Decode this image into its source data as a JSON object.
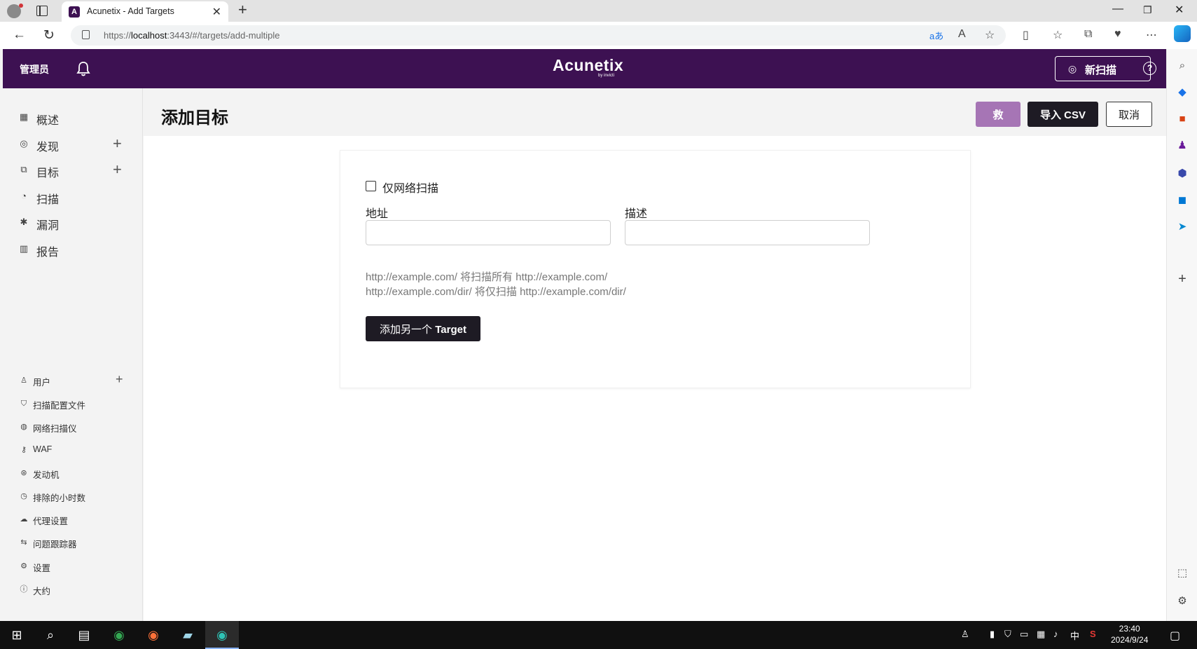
{
  "browser": {
    "tab_title": "Acunetix - Add Targets",
    "tab_favicon": "A",
    "url_prefix": "https://",
    "url_host": "localhost",
    "url_rest": ":3443/#/targets/add-multiple"
  },
  "header": {
    "user": "管理员",
    "logo": "Acunetix",
    "logo_sub": "by invicti",
    "new_scan": "新扫描",
    "help": "?"
  },
  "sidebar": {
    "main": [
      {
        "label": "概述",
        "icon": "grid-icon"
      },
      {
        "label": "发现",
        "icon": "target-icon"
      },
      {
        "label": "目标",
        "icon": "targets-icon"
      },
      {
        "label": "扫描",
        "icon": "scan-icon"
      },
      {
        "label": "漏洞",
        "icon": "bug-icon"
      },
      {
        "label": "报告",
        "icon": "chart-icon"
      }
    ],
    "settings": [
      {
        "label": "用户"
      },
      {
        "label": "扫描配置文件"
      },
      {
        "label": "网络扫描仪"
      },
      {
        "label": "WAF"
      },
      {
        "label": "发动机"
      },
      {
        "label": "排除的小时数"
      },
      {
        "label": "代理设置"
      },
      {
        "label": "问题跟踪器"
      },
      {
        "label": "设置"
      },
      {
        "label": "大约"
      }
    ]
  },
  "page": {
    "title": "添加目标",
    "save": "救",
    "import_csv": "导入 CSV",
    "cancel": "取消",
    "network_only": "仅网络扫描",
    "address_label": "地址",
    "description_label": "描述",
    "address_value": "",
    "description_value": "",
    "hint1": "http://example.com/ 将扫描所有 http://example.com/",
    "hint2": "http://example.com/dir/ 将仅扫描 http://example.com/dir/",
    "add_another_prefix": "添加另一个 ",
    "add_another_bold": "Target"
  },
  "taskbar": {
    "time": "23:40",
    "date": "2024/9/24",
    "ime": "中"
  },
  "colors": {
    "brand": "#3d1152",
    "save_button": "#a675b5",
    "dark_button": "#1e1b24"
  }
}
